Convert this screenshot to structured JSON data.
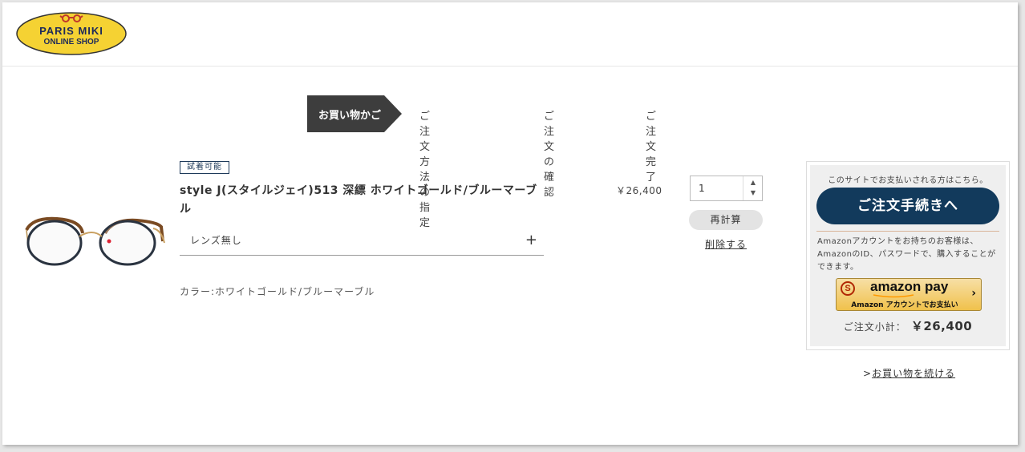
{
  "header": {
    "logo_line1": "PARIS MIKI",
    "logo_line2": "ONLINE SHOP",
    "logo_color": "#f5d233",
    "logo_border": "#333333",
    "glasses_color": "#c0392b"
  },
  "steps": [
    {
      "label": "お買い物かご",
      "active": true
    },
    {
      "label": "ご注文方法の指定",
      "active": false
    },
    {
      "label": "ご注文の確認",
      "active": false
    },
    {
      "label": "ご注文完了",
      "active": false
    }
  ],
  "cart_item": {
    "badge": "試着可能",
    "title": "style J(スタイルジェイ)513 深縹 ホワイトゴールド/ブルーマーブル",
    "lens_option": "レンズ無し",
    "color": "カラー:ホワイトゴールド/ブルーマーブル",
    "price": "￥26,400",
    "quantity": "1",
    "recalc_label": "再計算",
    "delete_label": "削除する"
  },
  "checkout": {
    "site_payment_note": "このサイトでお支払いされる方はこちら。",
    "checkout_button": "ご注文手続きへ",
    "amazon_note": "Amazonアカウントをお持ちのお客様は、AmazonのID、パスワードで、購入することができます。",
    "amazon_logo": "amazon pay",
    "amazon_sub": "Amazon アカウントでお支払い",
    "subtotal_label": "ご注文小計：",
    "subtotal_value": "￥26,400",
    "accent_color": "#123a5c",
    "amazon_color": "#f0c14b"
  },
  "continue_prefix": ">",
  "continue_link": "お買い物を続ける"
}
